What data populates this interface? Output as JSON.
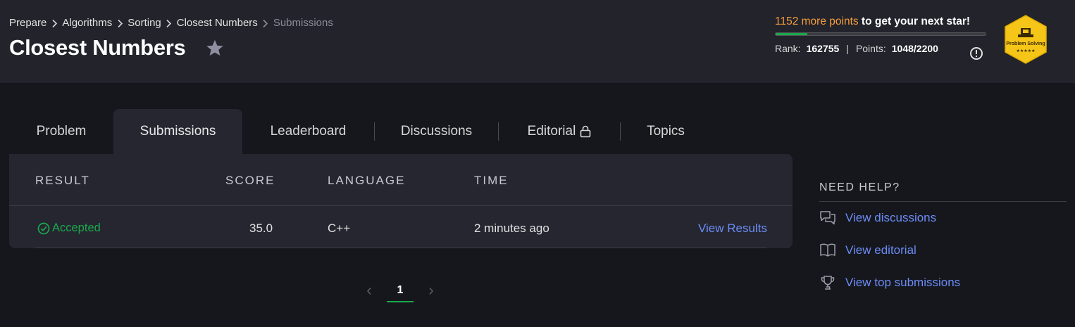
{
  "breadcrumb": [
    {
      "label": "Prepare"
    },
    {
      "label": "Algorithms"
    },
    {
      "label": "Sorting"
    },
    {
      "label": "Closest Numbers"
    },
    {
      "label": "Submissions"
    }
  ],
  "page_title": "Closest Numbers",
  "progress": {
    "points_needed": "1152 more points",
    "points_suffix": " to get your next star!",
    "fraction_to_next_star": 0.15,
    "rank_label": "Rank:",
    "rank_value": "162755",
    "points_label": "Points:",
    "points_value": "1048/2200",
    "divider": "|"
  },
  "badge": {
    "label": "Problem Solving",
    "stars": "★★★★★",
    "color": "#f5c518"
  },
  "tabs": [
    {
      "label": "Problem",
      "active": false
    },
    {
      "label": "Submissions",
      "active": true
    },
    {
      "label": "Leaderboard",
      "active": false
    },
    {
      "label": "Discussions",
      "active": false
    },
    {
      "label": "Editorial",
      "active": false,
      "icon": "lock-icon"
    },
    {
      "label": "Topics",
      "active": false
    }
  ],
  "table": {
    "headers": [
      "RESULT",
      "SCORE",
      "LANGUAGE",
      "TIME"
    ],
    "rows": [
      {
        "result": "Accepted",
        "score": "35.0",
        "language": "C++",
        "time": "2 minutes ago",
        "action": "View Results"
      }
    ]
  },
  "pagination": {
    "current": "1"
  },
  "help": {
    "title": "NEED HELP?",
    "links": [
      {
        "label": "View discussions",
        "icon": "chat-icon"
      },
      {
        "label": "View editorial",
        "icon": "book-icon"
      },
      {
        "label": "View top submissions",
        "icon": "trophy-icon"
      }
    ]
  },
  "colors": {
    "accent_green": "#1ba94c",
    "link_blue": "#6c8cf5",
    "points_orange": "#f59e3b"
  }
}
